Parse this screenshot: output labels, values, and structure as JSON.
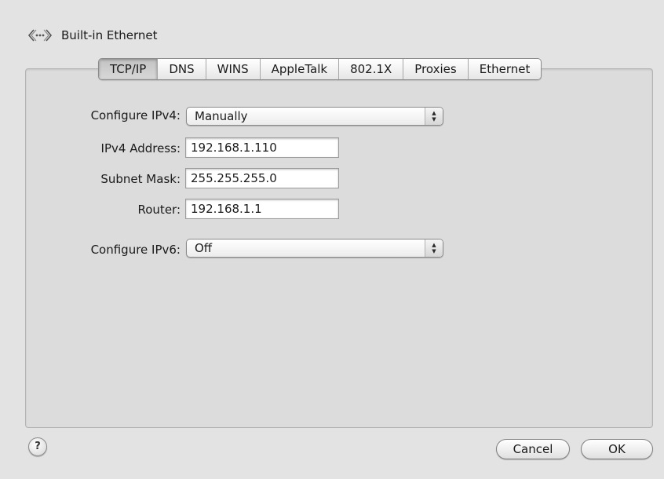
{
  "header": {
    "title": "Built-in Ethernet",
    "icon": "ethernet-icon"
  },
  "tabs": [
    {
      "label": "TCP/IP",
      "selected": true
    },
    {
      "label": "DNS"
    },
    {
      "label": "WINS"
    },
    {
      "label": "AppleTalk"
    },
    {
      "label": "802.1X"
    },
    {
      "label": "Proxies"
    },
    {
      "label": "Ethernet"
    }
  ],
  "form": {
    "configure_ipv4_label": "Configure IPv4:",
    "configure_ipv4_value": "Manually",
    "ipv4_address_label": "IPv4 Address:",
    "ipv4_address_value": "192.168.1.110",
    "subnet_mask_label": "Subnet Mask:",
    "subnet_mask_value": "255.255.255.0",
    "router_label": "Router:",
    "router_value": "192.168.1.1",
    "configure_ipv6_label": "Configure IPv6:",
    "configure_ipv6_value": "Off"
  },
  "buttons": {
    "help_glyph": "?",
    "cancel_label": "Cancel",
    "ok_label": "OK"
  }
}
